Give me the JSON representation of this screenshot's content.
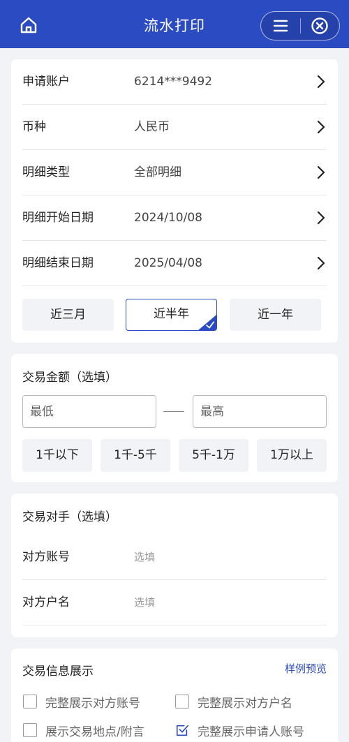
{
  "header": {
    "title": "流水打印",
    "home_icon": "home-icon",
    "menu_icon": "menu-icon",
    "close_icon": "close-circle-icon",
    "color": "#2b4bc3"
  },
  "account_form": {
    "rows": [
      {
        "label": "申请账户",
        "value": "6214***9492"
      },
      {
        "label": "币种",
        "value": "人民币"
      },
      {
        "label": "明细类型",
        "value": "全部明细"
      },
      {
        "label": "明细开始日期",
        "value": "2024/10/08"
      },
      {
        "label": "明细结束日期",
        "value": "2025/04/08"
      }
    ],
    "periods": [
      {
        "label": "近三月",
        "selected": false
      },
      {
        "label": "近半年",
        "selected": true
      },
      {
        "label": "近一年",
        "selected": false
      }
    ]
  },
  "amount": {
    "title": "交易金额（选填）",
    "min_placeholder": "最低",
    "max_placeholder": "最高",
    "quick": [
      "1千以下",
      "1千-5千",
      "5千-1万",
      "1万以上"
    ]
  },
  "counterparty": {
    "title": "交易对手（选填）",
    "account_label": "对方账号",
    "account_placeholder": "选填",
    "name_label": "对方户名",
    "name_placeholder": "选填"
  },
  "display": {
    "title": "交易信息展示",
    "preview_link": "样例预览",
    "options": [
      {
        "label": "完整展示对方账号",
        "checked": false
      },
      {
        "label": "完整展示对方户名",
        "checked": false
      },
      {
        "label": "展示交易地点/附言",
        "checked": false
      },
      {
        "label": "完整展示申请人账号",
        "checked": true
      }
    ]
  }
}
